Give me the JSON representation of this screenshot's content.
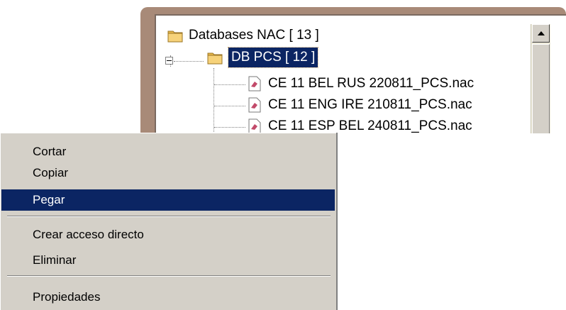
{
  "tree": {
    "root": {
      "label": "Databases NAC [ 13 ]"
    },
    "selected_node": {
      "label": "DB PCS [ 12 ]"
    },
    "files": [
      {
        "label": "CE 11 BEL RUS 220811_PCS.nac"
      },
      {
        "label": "CE 11 ENG IRE 210811_PCS.nac"
      },
      {
        "label": "CE 11 ESP BEL 240811_PCS.nac"
      }
    ]
  },
  "context_menu": {
    "items": [
      {
        "label": "Cortar"
      },
      {
        "label": "Copiar"
      },
      {
        "label": "Pegar",
        "highlighted": true
      },
      {
        "label": "Crear acceso directo"
      },
      {
        "label": "Eliminar"
      },
      {
        "label": "Propiedades"
      }
    ]
  },
  "colors": {
    "selection": "#0b2563",
    "menu_background": "#d4d0c8",
    "window_frame": "#a88a78",
    "folder": "#e8b84a"
  },
  "icons": {
    "folder": "folder-icon",
    "file": "nac-file-icon",
    "scroll_up": "scroll-up-arrow-icon",
    "collapse": "tree-collapse-icon"
  }
}
